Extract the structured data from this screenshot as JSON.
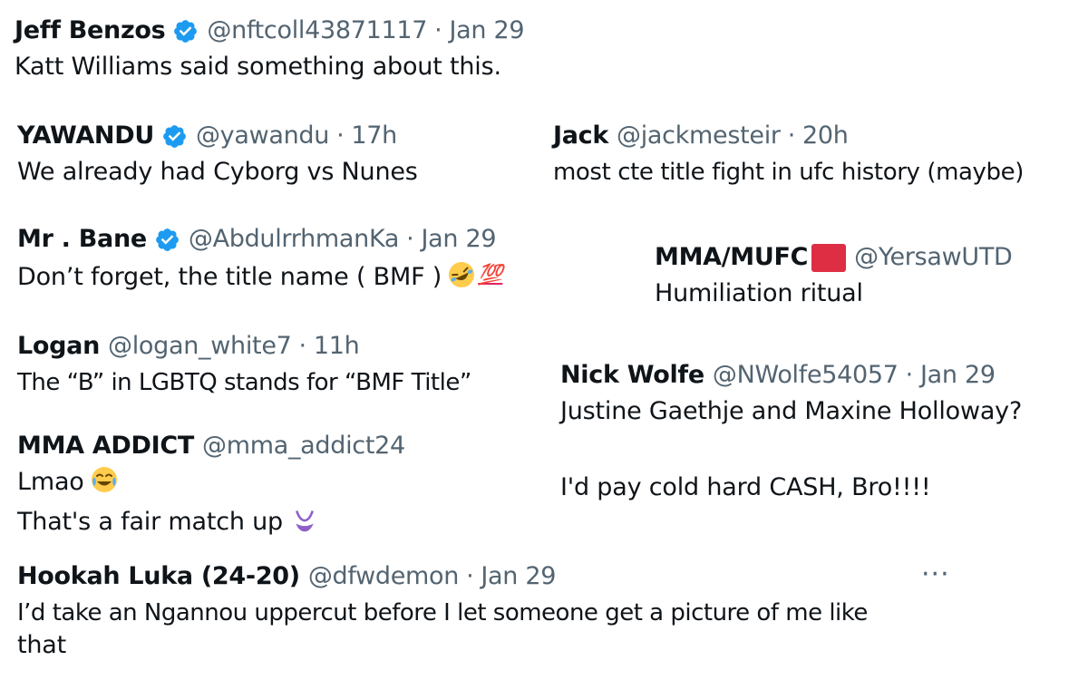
{
  "tweets": [
    {
      "name": "Jeff Benzos",
      "handle": "@nftcoll43871117",
      "sep": "·",
      "time": "Jan 29",
      "text": "Katt Williams said something about this."
    },
    {
      "name": "YAWANDU",
      "handle": "@yawandu",
      "sep": "·",
      "time": "17h",
      "text": "We already had Cyborg vs Nunes"
    },
    {
      "name": "Jack",
      "handle": "@jackmesteir",
      "sep": "·",
      "time": "20h",
      "text": "most cte title fight in ufc history (maybe)"
    },
    {
      "name": "Mr . Bane",
      "handle": "@AbdulrrhmanKa",
      "sep": "·",
      "time": "Jan 29",
      "text": "Don’t forget, the title name ( BMF )",
      "emoji_100": "💯"
    },
    {
      "name": "MMA/MUFC",
      "handle": "@YersawUTD",
      "text": "Humiliation ritual"
    },
    {
      "name": "Logan",
      "handle": "@logan_white7",
      "sep": "·",
      "time": "11h",
      "text": "The “B” in LGBTQ stands for “BMF Title”"
    },
    {
      "name": "Nick Wolfe",
      "handle": "@NWolfe54057",
      "sep": "·",
      "time": "Jan 29",
      "text": "Justine Gaethje and Maxine Holloway?",
      "text2": "I'd pay cold hard CASH, Bro!!!!"
    },
    {
      "name": "MMA ADDICT",
      "handle": "@mma_addict24",
      "text": "Lmao",
      "text2": "That's a fair match up"
    },
    {
      "name": "Hookah Luka (24-20)",
      "handle": "@dfwdemon",
      "sep": "·",
      "time": "Jan 29",
      "text": "I’d take an Ngannou uppercut before I let someone get a picture of me like",
      "text2": "that",
      "more": "···"
    }
  ],
  "colors": {
    "verified": "#1d9bf0",
    "secondary_text": "#536471",
    "primary_text": "#0f1419",
    "flag": "#dd2e44"
  },
  "icons": [
    "verified-badge-icon",
    "red-square-flag-icon",
    "rolling-laughing-emoji",
    "hundred-points-emoji",
    "tears-of-joy-emoji",
    "bikini-emoji",
    "more-options-icon"
  ]
}
